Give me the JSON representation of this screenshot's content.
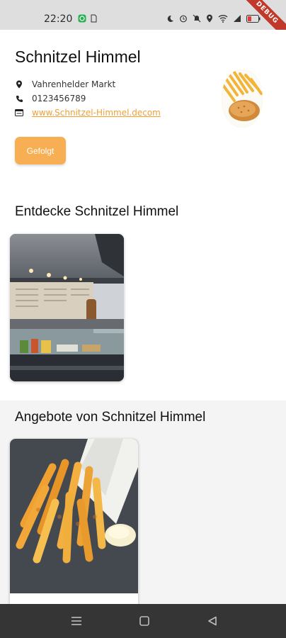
{
  "status_bar": {
    "time": "22:20",
    "debug_label": "DEBUG",
    "icons": [
      "whatsapp-icon",
      "sim-icon",
      "moon-icon",
      "alarm-icon",
      "mute-icon",
      "location-icon",
      "wifi-icon",
      "signal-icon",
      "battery-icon"
    ]
  },
  "restaurant": {
    "name": "Schnitzel Himmel",
    "address": "Vahrenhelder Markt",
    "phone": "0123456789",
    "website": "www.Schnitzel-Himmel.decom",
    "follow_label": "Gefolgt"
  },
  "sections": {
    "discover_title": "Entdecke Schnitzel Himmel",
    "offers_title": "Angebote von Schnitzel Himmel"
  },
  "colors": {
    "accent": "#f8ae52",
    "link": "#f0a035",
    "nav_bar": "#353535"
  },
  "nav": {
    "icons": [
      "recent-apps-icon",
      "home-icon",
      "back-icon"
    ]
  }
}
